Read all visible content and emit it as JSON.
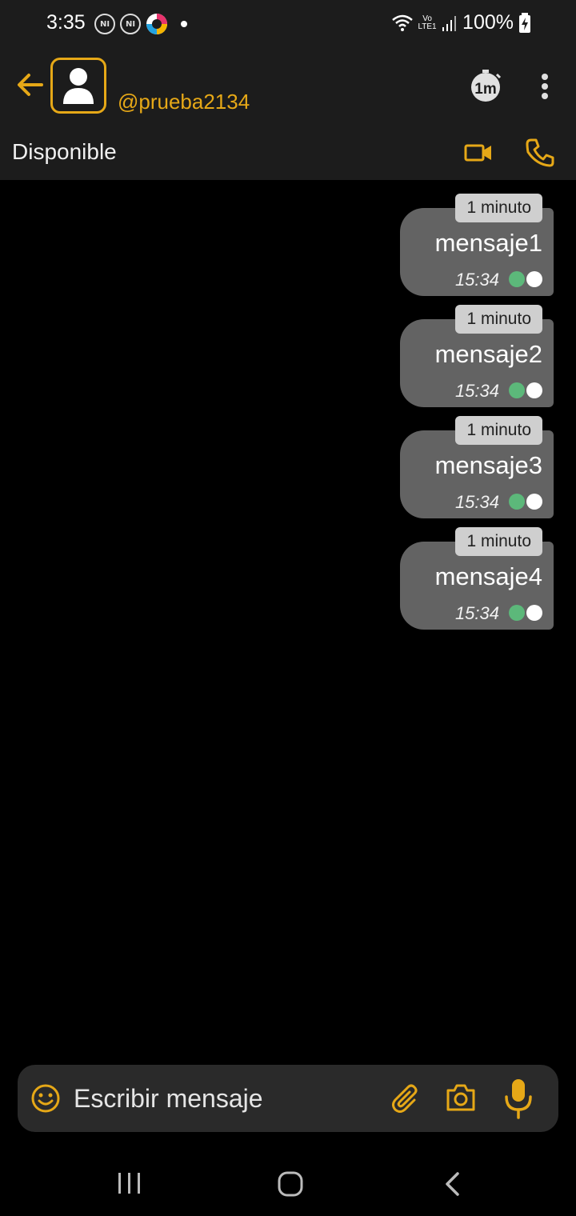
{
  "status_bar": {
    "time": "3:35",
    "notification_icons": [
      "ni-icon",
      "ni-icon",
      "app-icon"
    ],
    "network_label": "Vo LTE1",
    "battery": "100%"
  },
  "header": {
    "username": "@prueba2134",
    "presence": "Disponible",
    "timer_label": "1m",
    "accent_color": "#e6a817"
  },
  "messages": [
    {
      "ttl": "1 minuto",
      "text": "mensaje1",
      "time": "15:34"
    },
    {
      "ttl": "1 minuto",
      "text": "mensaje2",
      "time": "15:34"
    },
    {
      "ttl": "1 minuto",
      "text": "mensaje3",
      "time": "15:34"
    },
    {
      "ttl": "1 minuto",
      "text": "mensaje4",
      "time": "15:34"
    }
  ],
  "composer": {
    "placeholder": "Escribir mensaje"
  },
  "colors": {
    "accent": "#e6a817",
    "bubble": "#636363",
    "read_tick": "#5cb87a"
  }
}
